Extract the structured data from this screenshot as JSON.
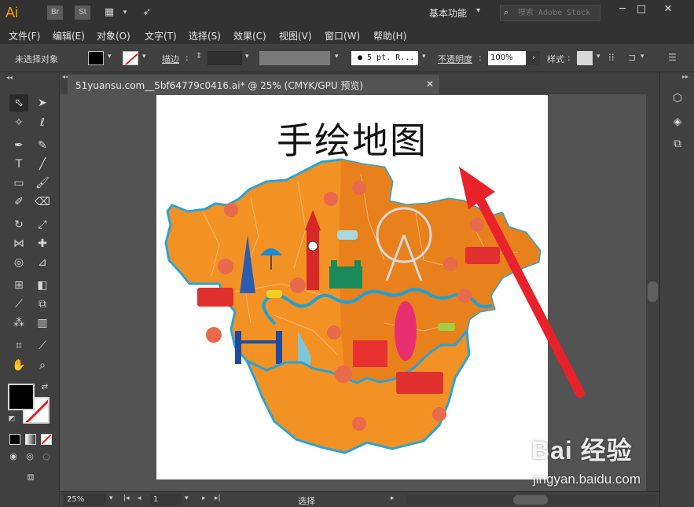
{
  "app": {
    "logo": "Ai",
    "bridge_label": "Br",
    "stock_label": "St",
    "workspace": "基本功能",
    "search_placeholder": "搜索 Adobe Stock"
  },
  "menu": [
    "文件(F)",
    "编辑(E)",
    "对象(O)",
    "文字(T)",
    "选择(S)",
    "效果(C)",
    "视图(V)",
    "窗口(W)",
    "帮助(H)"
  ],
  "control": {
    "selection_status": "未选择对象",
    "stroke_label": "描边",
    "brush_label": "5 pt. R...",
    "opacity_label": "不透明度",
    "opacity_value": "100%",
    "style_label": "样式"
  },
  "document": {
    "tab_title": "51yuansu.com__5bf64779c0416.ai* @ 25% (CMYK/GPU 预览)",
    "artboard_title": "手绘地图"
  },
  "status": {
    "zoom": "25%",
    "page": "1",
    "tool": "选择"
  },
  "watermark": {
    "brand": "Bai 经验",
    "url": "jingyan.baidu.com"
  },
  "colors": {
    "map_orange": "#f39224",
    "map_dark_orange": "#e8801c",
    "river_blue": "#1ea0d8",
    "arrow_red": "#e8222a"
  }
}
